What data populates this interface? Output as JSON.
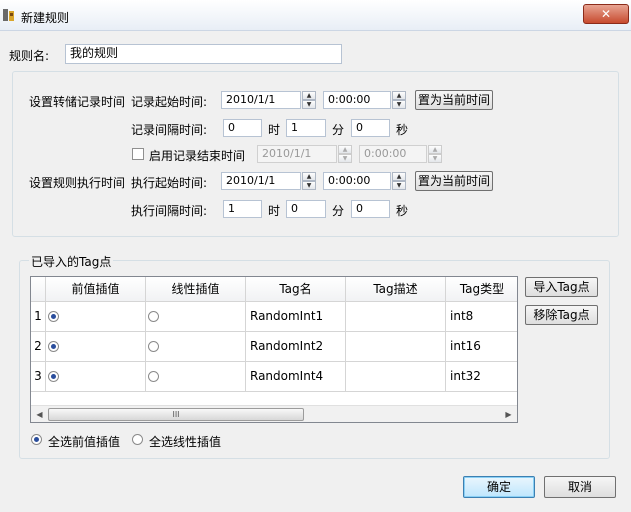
{
  "window": {
    "title": "新建规则",
    "close_glyph": "✕"
  },
  "rule_name": {
    "label": "规则名:",
    "value": "我的规则"
  },
  "storage": {
    "section_label": "设置转储记录时间",
    "start_label": "记录起始时间:",
    "start_date": "2010/1/1",
    "start_time": "0:00:00",
    "now_button": "置为当前时间",
    "interval_label": "记录间隔时间:",
    "hours": "0",
    "hours_unit": "时",
    "minutes": "1",
    "minutes_unit": "分",
    "seconds": "0",
    "seconds_unit": "秒",
    "enable_end_label": "启用记录结束时间",
    "end_date": "2010/1/1",
    "end_time": "0:00:00"
  },
  "execution": {
    "section_label": "设置规则执行时间",
    "start_label": "执行起始时间:",
    "start_date": "2010/1/1",
    "start_time": "0:00:00",
    "now_button": "置为当前时间",
    "interval_label": "执行间隔时间:",
    "hours": "1",
    "hours_unit": "时",
    "minutes": "0",
    "minutes_unit": "分",
    "seconds": "0",
    "seconds_unit": "秒"
  },
  "tags": {
    "group_label": "已导入的Tag点",
    "columns": [
      "前值插值",
      "线性插值",
      "Tag名",
      "Tag描述",
      "Tag类型"
    ],
    "rows": [
      {
        "index": "1",
        "prev": true,
        "linear": false,
        "name": "RandomInt1",
        "desc": "",
        "type": "int8"
      },
      {
        "index": "2",
        "prev": true,
        "linear": false,
        "name": "RandomInt2",
        "desc": "",
        "type": "int16"
      },
      {
        "index": "3",
        "prev": true,
        "linear": false,
        "name": "RandomInt4",
        "desc": "",
        "type": "int32"
      }
    ],
    "import_button": "导入Tag点",
    "remove_button": "移除Tag点",
    "select_all_prev": "全选前值插值",
    "select_all_linear": "全选线性插值",
    "scroll_grip": "III",
    "arrow_left": "◀",
    "arrow_right": "▶"
  },
  "buttons": {
    "ok": "确定",
    "cancel": "取消"
  },
  "icons": {
    "spin_up": "▲",
    "spin_down": "▼"
  }
}
